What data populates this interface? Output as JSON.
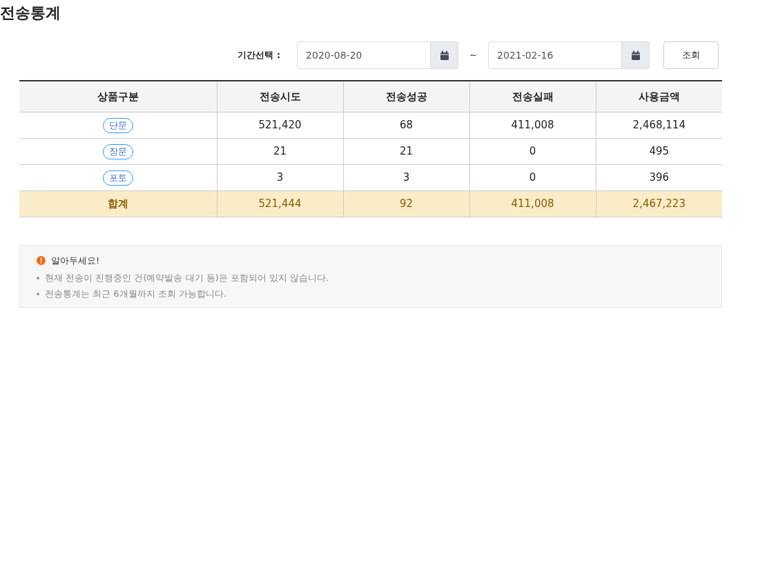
{
  "page_title": "전송통계",
  "filter": {
    "label": "기간선택 :",
    "start_date": "2020-08-20",
    "separator": "~",
    "end_date": "2021-02-16",
    "search_button": "조회"
  },
  "table": {
    "columns": [
      "상품구분",
      "전송시도",
      "전송성공",
      "전송실패",
      "사용금액"
    ],
    "rows": [
      {
        "kind": "item",
        "cells": [
          "단문",
          "521,420",
          "68",
          "411,008",
          "2,468,114"
        ]
      },
      {
        "kind": "item",
        "cells": [
          "장문",
          "21",
          "21",
          "0",
          "495"
        ]
      },
      {
        "kind": "item",
        "cells": [
          "포토",
          "3",
          "3",
          "0",
          "396"
        ]
      },
      {
        "kind": "total",
        "cells": [
          "합계",
          "521,444",
          "92",
          "411,008",
          "2,467,223"
        ]
      }
    ]
  },
  "notice": {
    "title": "알아두세요!",
    "items": [
      "현재 전송이 진행중인 건(예약발송 대기 등)은 포함되어 있지 않습니다.",
      "전송통계는 최근 6개월까지 조회 가능합니다."
    ]
  }
}
